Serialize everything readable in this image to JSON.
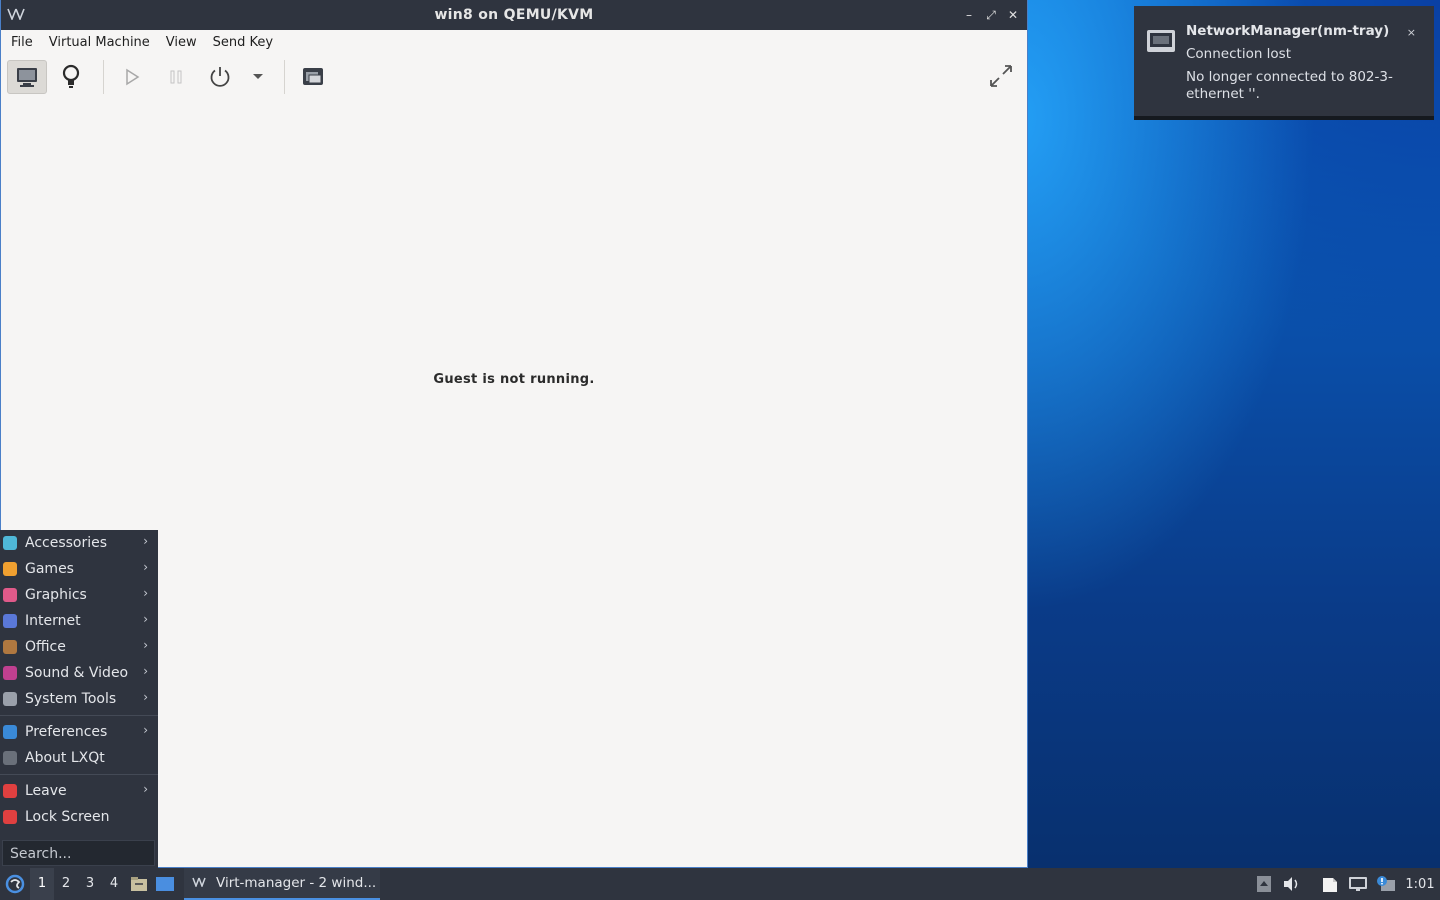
{
  "window": {
    "title": "win8 on QEMU/KVM",
    "app_icon": "virt-manager-icon",
    "minimize": "–",
    "maximize": "⤢",
    "close": "✕"
  },
  "menubar": [
    "File",
    "Virtual Machine",
    "View",
    "Send Key"
  ],
  "toolbar": {
    "icons": [
      "console-icon",
      "details-bulb-icon",
      "run-icon",
      "pause-icon",
      "power-icon",
      "dropdown-icon",
      "snapshots-icon",
      "fullscreen-icon"
    ]
  },
  "display": {
    "message": "Guest is not running."
  },
  "notification": {
    "app": "NetworkManager(nm-tray)",
    "summary": "Connection lost",
    "body": "No longer connected to 802-3-ethernet ''.",
    "close": "×"
  },
  "start_menu": {
    "items": [
      {
        "label": "Accessories",
        "submenu": true,
        "color": "#4fb8d8"
      },
      {
        "label": "Games",
        "submenu": true,
        "color": "#f0a030"
      },
      {
        "label": "Graphics",
        "submenu": true,
        "color": "#e05a8a"
      },
      {
        "label": "Internet",
        "submenu": true,
        "color": "#5a78d8"
      },
      {
        "label": "Office",
        "submenu": true,
        "color": "#b07840"
      },
      {
        "label": "Sound & Video",
        "submenu": true,
        "color": "#c04090"
      },
      {
        "label": "System Tools",
        "submenu": true,
        "color": "#9aa0aa"
      }
    ],
    "items2": [
      {
        "label": "Preferences",
        "submenu": true,
        "color": "#3a8ad8"
      },
      {
        "label": "About LXQt",
        "submenu": false,
        "color": "#6a707a"
      }
    ],
    "items3": [
      {
        "label": "Leave",
        "submenu": true,
        "color": "#e04040"
      },
      {
        "label": "Lock Screen",
        "submenu": false,
        "color": "#e04040"
      }
    ],
    "search_placeholder": "Search..."
  },
  "taskbar": {
    "desktops": [
      "1",
      "2",
      "3",
      "4"
    ],
    "active_desktop": "1",
    "task_label": "Virt-manager - 2 wind...",
    "clock": "1:01"
  },
  "colors": {
    "panel": "#2f343f",
    "accent": "#4a90e2",
    "window_bg": "#f6f5f4"
  }
}
